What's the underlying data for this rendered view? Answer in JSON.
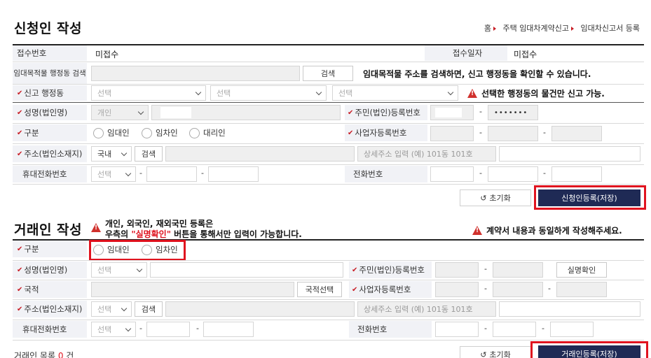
{
  "applicant": {
    "title": "신청인 작성",
    "breadcrumb": {
      "home": "홈",
      "level1": "주택 임대차계약신고",
      "level2": "임대차신고서 등록"
    },
    "receipt_no_label": "접수번호",
    "receipt_no_value": "미접수",
    "receipt_date_label": "접수일자",
    "receipt_date_value": "미접수",
    "property_search_label": "임대목적물 행정동 검색",
    "search_button": "검색",
    "property_search_hint": "임대목적물 주소를 검색하면, 신고 행정동을 확인할 수 있습니다.",
    "report_dong_label": "신고 행정동",
    "select_placeholder": "선택",
    "dong_notice": "선택한 행정동의 물건만 신고 가능.",
    "name_label": "성명(법인명)",
    "person_type": "개인",
    "resident_no_label": "주민(법인)등록번호",
    "resident_no_masked": "•••••••",
    "type_label": "구분",
    "type_options": [
      "임대인",
      "임차인",
      "대리인"
    ],
    "business_no_label": "사업자등록번호",
    "address_label": "주소(법인소재지)",
    "domestic": "국내",
    "detail_address_placeholder": "상세주소 입력 (예) 101동 101호",
    "mobile_label": "휴대전화번호",
    "phone_label": "전화번호",
    "dash": "-",
    "reset_button": "초기화",
    "register_button": "신청인등록(저장)"
  },
  "counterparty": {
    "title": "거래인 작성",
    "notice_line1": "개인, 외국인, 재외국민 등록은",
    "notice_line2_pre": "우측의 ",
    "notice_line2_em": "\"실명확인\"",
    "notice_line2_post": " 버튼을 통해서만 입력이 가능합니다.",
    "right_notice": "계약서 내용과 동일하게 작성해주세요.",
    "type_label": "구분",
    "type_options": [
      "임대인",
      "임차인"
    ],
    "name_label": "성명(법인명)",
    "resident_no_label": "주민(법인)등록번호",
    "verify_button": "실명확인",
    "nationality_label": "국적",
    "nationality_button": "국적선택",
    "business_no_label": "사업자등록번호",
    "address_label": "주소(법인소재지)",
    "select_placeholder": "선택",
    "search_button": "검색",
    "detail_address_placeholder": "상세주소 입력 (예) 101동 101호",
    "mobile_label": "휴대전화번호",
    "phone_label": "전화번호",
    "dash": "-",
    "reset_button": "초기화",
    "register_button": "거래인등록(저장)",
    "list_label_pre": "거래인 목록 ",
    "list_count": "0",
    "list_label_post": " 건"
  },
  "colors": {
    "accent_red": "#e0131f",
    "navy": "#1f2a55",
    "label_bg": "#f1f2f6"
  }
}
